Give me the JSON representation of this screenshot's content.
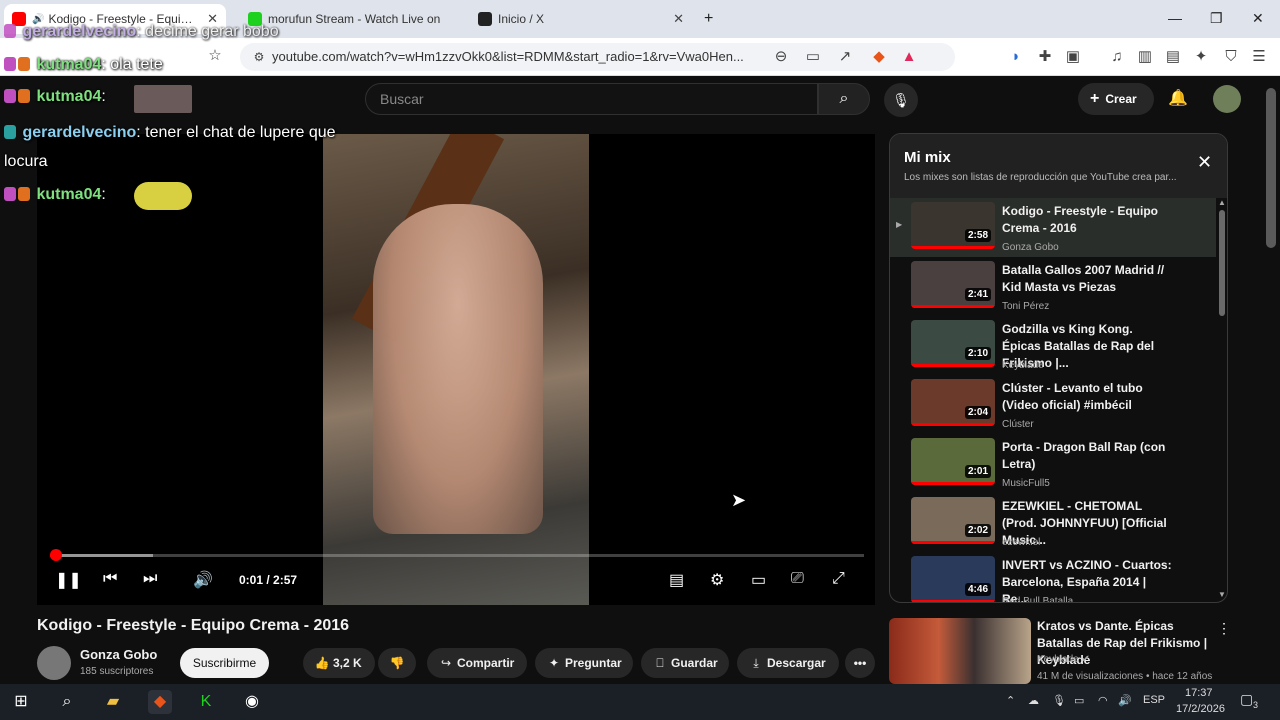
{
  "browser": {
    "tabs": [
      {
        "title": "Kodigo - Freestyle - Equipo C",
        "active": true
      },
      {
        "title": "morufun Stream - Watch Live on",
        "active": false
      },
      {
        "title": "Inicio / X",
        "active": false
      }
    ],
    "new_tab": "+",
    "url": "youtube.com/watch?v=wHm1zzvOkk0&list=RDMM&start_radio=1&rv=Vwa0Hen..."
  },
  "youtube": {
    "search_placeholder": "Buscar",
    "create_label": "Crear",
    "video": {
      "title": "Kodigo - Freestyle - Equipo Crema - 2016",
      "time": "0:01 / 2:57",
      "progress_fraction": 0.006,
      "buffered_fraction": 0.127
    },
    "channel": {
      "name": "Gonza Gobo",
      "subscribers": "185 suscriptores",
      "subscribe_label": "Suscribirme"
    },
    "actions": {
      "likes": "3,2 K",
      "share": "Compartir",
      "ask": "Preguntar",
      "save": "Guardar",
      "download": "Descargar"
    },
    "mix": {
      "title": "Mi mix",
      "description": "Los mixes son listas de reproducción que YouTube crea par...",
      "items": [
        {
          "title": "Kodigo - Freestyle - Equipo Crema - 2016",
          "channel": "Gonza Gobo",
          "duration": "2:58",
          "color": "#3b3530"
        },
        {
          "title": "Batalla Gallos 2007 Madrid // Kid Masta vs Piezas",
          "channel": "Toni Pérez",
          "duration": "2:41",
          "color": "#4a4040"
        },
        {
          "title": "Godzilla vs King Kong. Épicas Batallas de Rap del Frikismo |...",
          "channel": "Keyblade",
          "duration": "2:10",
          "color": "#3c4a44"
        },
        {
          "title": "Clúster - Levanto el tubo (Video oficial) #imbécil",
          "channel": "Clúster",
          "duration": "2:04",
          "color": "#6b3a2a"
        },
        {
          "title": "Porta - Dragon Ball Rap (con Letra)",
          "channel": "MusicFull5",
          "duration": "2:01",
          "color": "#5a6a3a"
        },
        {
          "title": "EZEWKIEL - CHETOMAL (Prod. JOHNNYFUU) [Official Music...",
          "channel": "ezewkiel",
          "duration": "2:02",
          "color": "#7a6a5a"
        },
        {
          "title": "INVERT vs ACZINO - Cuartos: Barcelona, España 2014 | Re...",
          "channel": "Red Bull Batalla",
          "duration": "4:46",
          "color": "#2a3a5a"
        }
      ]
    },
    "recommendation": {
      "title": "Kratos vs Dante. Épicas Batallas de Rap del Frikismo | Keyblade",
      "channel": "Keyblade",
      "meta": "41 M de visualizaciones • hace 12 años"
    }
  },
  "chat_overlay": [
    {
      "user": "gerardelvecino",
      "text": ": decime gerar bobo",
      "color": "#b9a0e0"
    },
    {
      "user": "kutma04",
      "text": ": ola tete",
      "color": "#7ee07e"
    },
    {
      "user": "kutma04",
      "text": ":",
      "color": "#7ee07e"
    },
    {
      "user": "gerardelvecino",
      "text": ": tener el chat de lupere que",
      "color": "#8ad0f0"
    },
    {
      "user": "",
      "text": "locura",
      "color": "#ffffff"
    },
    {
      "user": "kutma04",
      "text": ":",
      "color": "#7ee07e"
    }
  ],
  "taskbar": {
    "lang": "ESP",
    "time": "17:37",
    "date": "17/2/2026",
    "notifications": "3"
  }
}
